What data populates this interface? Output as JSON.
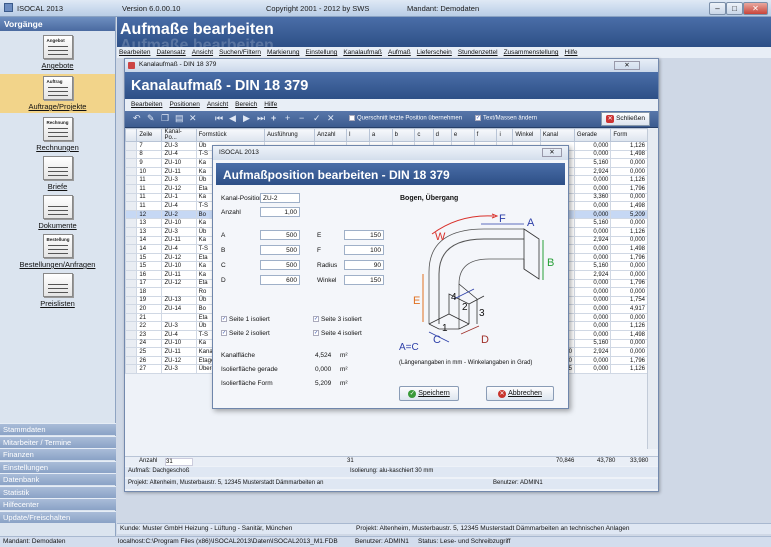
{
  "app": {
    "name": "ISOCAL 2013",
    "version": "Version 6.0.00.10",
    "copyright": "Copyright 2001 - 2012 by SWS",
    "mandant": "Mandant: Demodaten"
  },
  "sidebar": {
    "header": "Vorgänge",
    "items": [
      {
        "label": "Angebote",
        "icon_text": "Angebot"
      },
      {
        "label": "Auftrage/Projekte",
        "icon_text": "Auftrag"
      },
      {
        "label": "Rechnungen",
        "icon_text": "Rechnung"
      },
      {
        "label": "Briefe",
        "icon_text": ""
      },
      {
        "label": "Dokumente",
        "icon_text": ""
      },
      {
        "label": "Bestellungen/Anfragen",
        "icon_text": "Bestellung"
      },
      {
        "label": "Preislisten",
        "icon_text": ""
      }
    ],
    "bottom_items": [
      "Stammdaten",
      "Mitarbeiter / Termine",
      "Finanzen",
      "Einstellungen",
      "Datenbank",
      "Statistik",
      "Hilfecenter",
      "Update/Freischalten"
    ],
    "mandant_footer": "Mandant: Demodaten"
  },
  "main": {
    "title": "Aufmaße bearbeiten",
    "menu": [
      "Bearbeiten",
      "Datensatz",
      "Ansicht",
      "Suchen/Filtern",
      "Markierung",
      "Einstellung",
      "Kanalaufmaß",
      "Aufmaß",
      "Lieferschein",
      "Stundenzettel",
      "Zusammenstellung",
      "Hilfe"
    ]
  },
  "kanal_window": {
    "title": "Kanalaufmaß - DIN 18 379",
    "heading": "Kanalaufmaß - DIN 18 379",
    "menu": [
      "Bearbeiten",
      "Positionen",
      "Ansicht",
      "Bereich",
      "Hilfe"
    ],
    "toolbar": {
      "check1": "Querschnitt letzte Position übernehmen",
      "check2": "Text/Massen ändern",
      "close_label": "Schließen"
    },
    "columns": [
      "Zeile",
      "Kanal-Po...",
      "Formstück",
      "Ausführung",
      "Anzahl",
      "l",
      "a",
      "b",
      "c",
      "d",
      "e",
      "f",
      "i",
      "Winkel",
      "Kanal",
      "Gerade",
      "Form"
    ],
    "rows": [
      [
        "7",
        "ZU-3",
        "Üb",
        "",
        "",
        "",
        "",
        "",
        "",
        "",
        "",
        "",
        "",
        "",
        "",
        "0,000",
        "1,126"
      ],
      [
        "8",
        "ZU-4",
        "T-S",
        "",
        "",
        "",
        "",
        "",
        "",
        "",
        "",
        "",
        "",
        "",
        "",
        "0,000",
        "1,498"
      ],
      [
        "9",
        "ZU-10",
        "Ka",
        "",
        "",
        "",
        "",
        "",
        "",
        "",
        "",
        "",
        "",
        "",
        "",
        "5,160",
        "0,000"
      ],
      [
        "10",
        "ZU-11",
        "Ka",
        "",
        "",
        "",
        "",
        "",
        "",
        "",
        "",
        "",
        "",
        "",
        "",
        "2,924",
        "0,000"
      ],
      [
        "11",
        "ZU-3",
        "Üb",
        "",
        "",
        "",
        "",
        "",
        "",
        "",
        "",
        "",
        "",
        "",
        "",
        "0,000",
        "1,126"
      ],
      [
        "11",
        "ZU-12",
        "Eta",
        "",
        "",
        "",
        "",
        "",
        "",
        "",
        "",
        "",
        "",
        "",
        "",
        "0,000",
        "1,796"
      ],
      [
        "11",
        "ZU-1",
        "Ka",
        "",
        "",
        "",
        "",
        "",
        "",
        "",
        "",
        "",
        "",
        "",
        "",
        "3,360",
        "0,000"
      ],
      [
        "11",
        "ZU-4",
        "T-S",
        "",
        "",
        "",
        "",
        "",
        "",
        "",
        "",
        "",
        "",
        "",
        "",
        "0,000",
        "1,498"
      ],
      [
        "12",
        "ZU-2",
        "Bo",
        "",
        "",
        "",
        "",
        "",
        "",
        "",
        "",
        "",
        "",
        "",
        "",
        "0,000",
        "5,209"
      ],
      [
        "13",
        "ZU-10",
        "Ka",
        "",
        "",
        "",
        "",
        "",
        "",
        "",
        "",
        "",
        "",
        "",
        "",
        "5,160",
        "0,000"
      ],
      [
        "13",
        "ZU-3",
        "Üb",
        "",
        "",
        "",
        "",
        "",
        "",
        "",
        "",
        "",
        "",
        "",
        "",
        "0,000",
        "1,126"
      ],
      [
        "14",
        "ZU-11",
        "Ka",
        "",
        "",
        "",
        "",
        "",
        "",
        "",
        "",
        "",
        "",
        "",
        "",
        "2,924",
        "0,000"
      ],
      [
        "14",
        "ZU-4",
        "T-S",
        "",
        "",
        "",
        "",
        "",
        "",
        "",
        "",
        "",
        "",
        "",
        "",
        "0,000",
        "1,498"
      ],
      [
        "15",
        "ZU-12",
        "Eta",
        "",
        "",
        "",
        "",
        "",
        "",
        "",
        "",
        "",
        "",
        "",
        "",
        "0,000",
        "1,796"
      ],
      [
        "15",
        "ZU-10",
        "Ka",
        "",
        "",
        "",
        "",
        "",
        "",
        "",
        "",
        "",
        "",
        "",
        "",
        "5,160",
        "0,000"
      ],
      [
        "16",
        "ZU-11",
        "Ka",
        "",
        "",
        "",
        "",
        "",
        "",
        "",
        "",
        "",
        "",
        "",
        "",
        "2,924",
        "0,000"
      ],
      [
        "17",
        "ZU-12",
        "Eta",
        "",
        "",
        "",
        "",
        "",
        "",
        "",
        "",
        "",
        "",
        "",
        "",
        "0,000",
        "1,796"
      ],
      [
        "18",
        "",
        "Ro",
        "",
        "",
        "",
        "",
        "",
        "",
        "",
        "",
        "",
        "",
        "",
        "",
        "0,000",
        "0,000"
      ],
      [
        "19",
        "ZU-13",
        "Üb",
        "",
        "",
        "",
        "",
        "",
        "",
        "",
        "",
        "",
        "",
        "",
        "",
        "0,000",
        "1,754"
      ],
      [
        "20",
        "ZU-14",
        "Bo",
        "",
        "",
        "",
        "",
        "",
        "",
        "",
        "",
        "",
        "",
        "",
        "",
        "0,000",
        "4,917"
      ],
      [
        "21",
        "",
        "Eta",
        "",
        "",
        "",
        "",
        "",
        "",
        "",
        "",
        "",
        "",
        "",
        "",
        "0,000",
        "0,000"
      ],
      [
        "22",
        "ZU-3",
        "Üb",
        "",
        "",
        "",
        "",
        "",
        "",
        "",
        "",
        "",
        "",
        "",
        "",
        "0,000",
        "1,126"
      ],
      [
        "23",
        "ZU-4",
        "T-S",
        "",
        "",
        "",
        "",
        "",
        "",
        "",
        "",
        "",
        "",
        "",
        "",
        "0,000",
        "1,498"
      ],
      [
        "24",
        "ZU-10",
        "Ka",
        "",
        "",
        "",
        "",
        "",
        "",
        "",
        "",
        "",
        "",
        "",
        "",
        "5,160",
        "0,000"
      ],
      [
        "25",
        "ZU-11",
        "Kanalstück",
        "4-seitig",
        "1,00",
        "850",
        "800",
        "800",
        "0",
        "0",
        "0",
        "0",
        "0",
        "0",
        "2,720",
        "2,924",
        "0,000"
      ],
      [
        "26",
        "ZU-12",
        "Etage, symetr.",
        "4-seitig",
        "1,00",
        "500",
        "800",
        "800",
        "0",
        "0",
        "150",
        "0",
        "0",
        "0",
        "1,670",
        "0,000",
        "1,796"
      ],
      [
        "27",
        "ZU-3",
        "Übergang, asymetr.",
        "4-seitig",
        "1,00",
        "500",
        "500",
        "500",
        "400",
        "300",
        "-150",
        "-130",
        "0",
        "0",
        "1,005",
        "0,000",
        "1,126"
      ]
    ],
    "highlight_row": 8,
    "sum": {
      "label": "Anzahl",
      "count": "31",
      "anzahl": "31",
      "kanal": "70,846",
      "gerade": "43,780",
      "form": "33,980"
    },
    "status_a_left": "Aufmaß: Dachgeschoß",
    "status_a_right": "Isolierung: alu-kaschiert 30 mm",
    "status_b_left": "Projekt: Altenheim, Musterbaustr. 5, 12345 Musterstadt  Dämmarbeiten an",
    "status_b_right": "Benutzer: ADMIN1"
  },
  "dialog": {
    "title": "ISOCAL 2013",
    "heading": "Aufmaßposition bearbeiten - DIN 18 379",
    "kanal_position_label": "Kanal-Position",
    "kanal_position": "ZU-2",
    "anzahl_label": "Anzahl",
    "anzahl": "1,00",
    "fields_left": [
      {
        "label": "A",
        "value": "500"
      },
      {
        "label": "B",
        "value": "500"
      },
      {
        "label": "C",
        "value": "500"
      },
      {
        "label": "D",
        "value": "600"
      }
    ],
    "fields_right": [
      {
        "label": "E",
        "value": "150"
      },
      {
        "label": "F",
        "value": "100"
      },
      {
        "label": "Radius",
        "value": "90"
      },
      {
        "label": "Winkel",
        "value": "150"
      }
    ],
    "checkboxes": [
      {
        "label": "Seite 1 isoliert",
        "checked": true
      },
      {
        "label": "Seite 3 isoliert",
        "checked": true
      },
      {
        "label": "Seite 2 isoliert",
        "checked": true
      },
      {
        "label": "Seite 4 isoliert",
        "checked": true
      }
    ],
    "results": [
      {
        "label": "Kanalfläche",
        "value": "4,524",
        "unit": "m²"
      },
      {
        "label": "Isolierfläche gerade",
        "value": "0,000",
        "unit": "m²"
      },
      {
        "label": "Isolierfläche Form",
        "value": "5,209",
        "unit": "m²"
      }
    ],
    "shape_title": "Bogen, Übergang",
    "shape_letters": {
      "W": "W",
      "F": "F",
      "A": "A",
      "B": "B",
      "E": "E",
      "C": "C",
      "D": "D",
      "n1": "1",
      "n2": "2",
      "n3": "3",
      "n4": "4"
    },
    "equation": "A=C",
    "note": "(Längenangaben in mm - Winkelangaben in Grad)",
    "save_label": "Speichern",
    "cancel_label": "Abbrechen"
  },
  "footer": {
    "kunde": "Kunde: Muster GmbH  Heizung - Lüftung - Sanitär, München",
    "projekt": "Projekt: Altenheim, Musterbaustr. 5, 12345 Musterstadt  Dämmarbeiten an technischen Anlagen",
    "path": "localhost:C:\\Program Files (x86)\\ISOCAL2013\\Daten\\ISOCAL2013_M1.FDB",
    "benutzer": "Benutzer: ADMIN1",
    "status": "Status: Lese- und Schreibzugriff"
  }
}
